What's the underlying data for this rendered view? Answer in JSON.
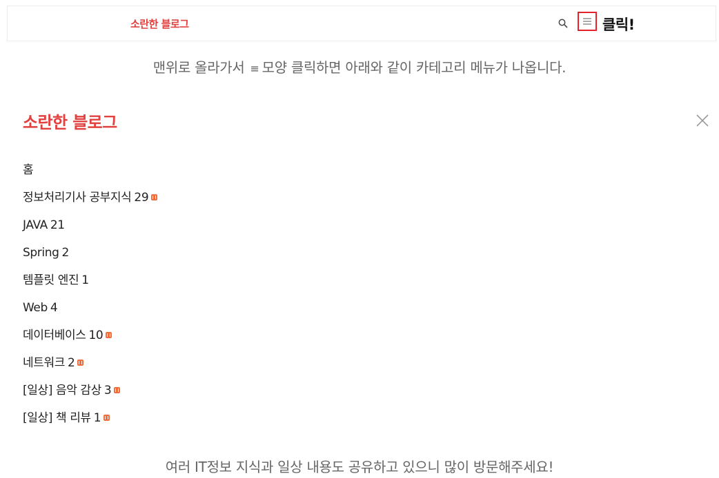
{
  "header": {
    "blog_title": "소란한 블로그",
    "click_label": "클릭!",
    "icons": {
      "search": "search-icon",
      "menu": "hamburger-menu-icon"
    }
  },
  "captions": {
    "top_before": "맨위로 올라가서",
    "top_glyph": "≡",
    "top_after": "모양 클릭하면 아래와 같이 카테고리 메뉴가 나옵니다.",
    "bottom": "여러 IT정보 지식과 일상 내용도 공유하고 있으니 많이 방문해주세요!"
  },
  "panel": {
    "title": "소란한 블로그",
    "close_icon": "close-icon",
    "categories": [
      {
        "label": "홈",
        "count": "",
        "new": false
      },
      {
        "label": "정보처리기사 공부지식",
        "count": "29",
        "new": true
      },
      {
        "label": "JAVA",
        "count": "21",
        "new": false
      },
      {
        "label": "Spring",
        "count": "2",
        "new": false
      },
      {
        "label": "템플릿 엔진",
        "count": "1",
        "new": false
      },
      {
        "label": "Web",
        "count": "4",
        "new": false
      },
      {
        "label": "데이터베이스",
        "count": "10",
        "new": true
      },
      {
        "label": "네트워크",
        "count": "2",
        "new": true
      },
      {
        "label": "[일상] 음악 감상",
        "count": "3",
        "new": true
      },
      {
        "label": "[일상] 책 리뷰",
        "count": "1",
        "new": true
      }
    ]
  },
  "colors": {
    "brand": "#e2413f",
    "highlight_border": "#e8202a",
    "new_badge": "#f26b3a"
  }
}
